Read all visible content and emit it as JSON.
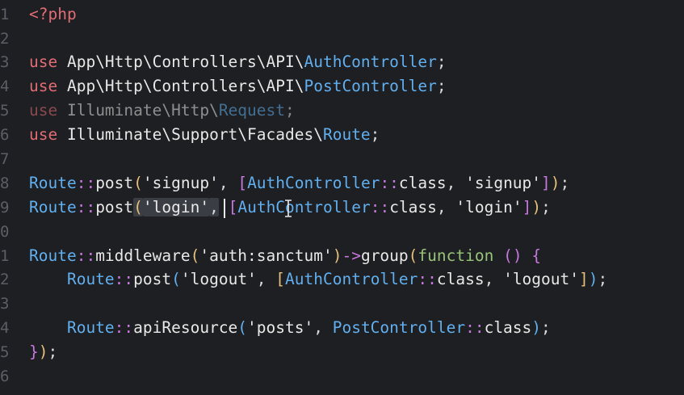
{
  "editor": {
    "lines": [
      {
        "n": "1",
        "tokens": [
          {
            "c": "t-tag",
            "t": "<?php"
          }
        ]
      },
      {
        "n": "2",
        "tokens": []
      },
      {
        "n": "3",
        "tokens": [
          {
            "c": "t-kw",
            "t": "use"
          },
          {
            "c": "t-ns",
            "t": " App\\Http\\Controllers\\API\\"
          },
          {
            "c": "t-cls",
            "t": "AuthController"
          },
          {
            "c": "t-op",
            "t": ";"
          }
        ]
      },
      {
        "n": "4",
        "tokens": [
          {
            "c": "t-kw",
            "t": "use"
          },
          {
            "c": "t-ns",
            "t": " App\\Http\\Controllers\\API\\"
          },
          {
            "c": "t-cls",
            "t": "PostController"
          },
          {
            "c": "t-op",
            "t": ";"
          }
        ]
      },
      {
        "n": "5",
        "dim": true,
        "tokens": [
          {
            "c": "t-kw",
            "t": "use"
          },
          {
            "c": "t-ns",
            "t": " Illuminate\\Http\\"
          },
          {
            "c": "t-cls",
            "t": "Request"
          },
          {
            "c": "t-op",
            "t": ";"
          }
        ]
      },
      {
        "n": "6",
        "tokens": [
          {
            "c": "t-kw",
            "t": "use"
          },
          {
            "c": "t-ns",
            "t": " Illuminate\\Support\\Facades\\"
          },
          {
            "c": "t-cls",
            "t": "Route"
          },
          {
            "c": "t-op",
            "t": ";"
          }
        ]
      },
      {
        "n": "7",
        "tokens": []
      },
      {
        "n": "8",
        "tokens": [
          {
            "c": "t-route",
            "t": "Route"
          },
          {
            "c": "t-dcolon",
            "t": "::"
          },
          {
            "c": "t-fn",
            "t": "post"
          },
          {
            "c": "t-bracket-y",
            "t": "("
          },
          {
            "c": "t-str",
            "t": "'signup'"
          },
          {
            "c": "t-op",
            "t": ", "
          },
          {
            "c": "t-bracket-m",
            "t": "["
          },
          {
            "c": "t-cls",
            "t": "AuthController"
          },
          {
            "c": "t-dcolon",
            "t": "::"
          },
          {
            "c": "t-fn",
            "t": "class"
          },
          {
            "c": "t-op",
            "t": ", "
          },
          {
            "c": "t-str",
            "t": "'signup'"
          },
          {
            "c": "t-bracket-m",
            "t": "]"
          },
          {
            "c": "t-bracket-y",
            "t": ")"
          },
          {
            "c": "t-op",
            "t": ";"
          }
        ]
      },
      {
        "n": "9",
        "tokens": [
          {
            "c": "t-route",
            "t": "Route"
          },
          {
            "c": "t-dcolon",
            "t": "::"
          },
          {
            "c": "t-fn",
            "t": "post"
          },
          {
            "c": "t-bracket-y sel",
            "t": "("
          },
          {
            "c": "t-str sel",
            "t": "'login'"
          },
          {
            "c": "t-op sel",
            "t": ","
          },
          {
            "c": "t-op",
            "t": " "
          },
          {
            "c": "t-bracket-m",
            "t": "["
          },
          {
            "c": "t-cls",
            "t": "AuthController"
          },
          {
            "c": "t-dcolon",
            "t": "::"
          },
          {
            "c": "t-fn",
            "t": "class"
          },
          {
            "c": "t-op",
            "t": ", "
          },
          {
            "c": "t-str",
            "t": "'login'"
          },
          {
            "c": "t-bracket-m",
            "t": "]"
          },
          {
            "c": "t-bracket-y",
            "t": ")"
          },
          {
            "c": "t-op",
            "t": ";"
          }
        ]
      },
      {
        "n": "0",
        "tokens": []
      },
      {
        "n": "1",
        "tokens": [
          {
            "c": "t-route",
            "t": "Route"
          },
          {
            "c": "t-dcolon",
            "t": "::"
          },
          {
            "c": "t-fn",
            "t": "middleware"
          },
          {
            "c": "t-bracket-y",
            "t": "("
          },
          {
            "c": "t-str",
            "t": "'auth:sanctum'"
          },
          {
            "c": "t-bracket-y",
            "t": ")"
          },
          {
            "c": "t-arrow",
            "t": "->"
          },
          {
            "c": "t-fn",
            "t": "group"
          },
          {
            "c": "t-bracket-y",
            "t": "("
          },
          {
            "c": "t-func",
            "t": "function"
          },
          {
            "c": "t-op",
            "t": " "
          },
          {
            "c": "t-bracket-m",
            "t": "()"
          },
          {
            "c": "t-op",
            "t": " "
          },
          {
            "c": "t-bracket-m",
            "t": "{"
          }
        ]
      },
      {
        "n": "2",
        "tokens": [
          {
            "c": "t-op",
            "t": "    "
          },
          {
            "c": "t-route",
            "t": "Route"
          },
          {
            "c": "t-dcolon",
            "t": "::"
          },
          {
            "c": "t-fn",
            "t": "post"
          },
          {
            "c": "t-bracket-b",
            "t": "("
          },
          {
            "c": "t-str",
            "t": "'logout'"
          },
          {
            "c": "t-op",
            "t": ", "
          },
          {
            "c": "t-bracket-y",
            "t": "["
          },
          {
            "c": "t-cls",
            "t": "AuthController"
          },
          {
            "c": "t-dcolon",
            "t": "::"
          },
          {
            "c": "t-fn",
            "t": "class"
          },
          {
            "c": "t-op",
            "t": ", "
          },
          {
            "c": "t-str",
            "t": "'logout'"
          },
          {
            "c": "t-bracket-y",
            "t": "]"
          },
          {
            "c": "t-bracket-b",
            "t": ")"
          },
          {
            "c": "t-op",
            "t": ";"
          }
        ]
      },
      {
        "n": "3",
        "tokens": []
      },
      {
        "n": "4",
        "tokens": [
          {
            "c": "t-op",
            "t": "    "
          },
          {
            "c": "t-route",
            "t": "Route"
          },
          {
            "c": "t-dcolon",
            "t": "::"
          },
          {
            "c": "t-fn",
            "t": "apiResource"
          },
          {
            "c": "t-bracket-b",
            "t": "("
          },
          {
            "c": "t-str",
            "t": "'posts'"
          },
          {
            "c": "t-op",
            "t": ", "
          },
          {
            "c": "t-cls",
            "t": "PostController"
          },
          {
            "c": "t-dcolon",
            "t": "::"
          },
          {
            "c": "t-fn",
            "t": "class"
          },
          {
            "c": "t-bracket-b",
            "t": ")"
          },
          {
            "c": "t-op",
            "t": ";"
          }
        ]
      },
      {
        "n": "5",
        "tokens": [
          {
            "c": "t-bracket-m",
            "t": "}"
          },
          {
            "c": "t-bracket-y",
            "t": ")"
          },
          {
            "c": "t-op",
            "t": ";"
          }
        ]
      },
      {
        "n": "6",
        "tokens": []
      }
    ]
  }
}
